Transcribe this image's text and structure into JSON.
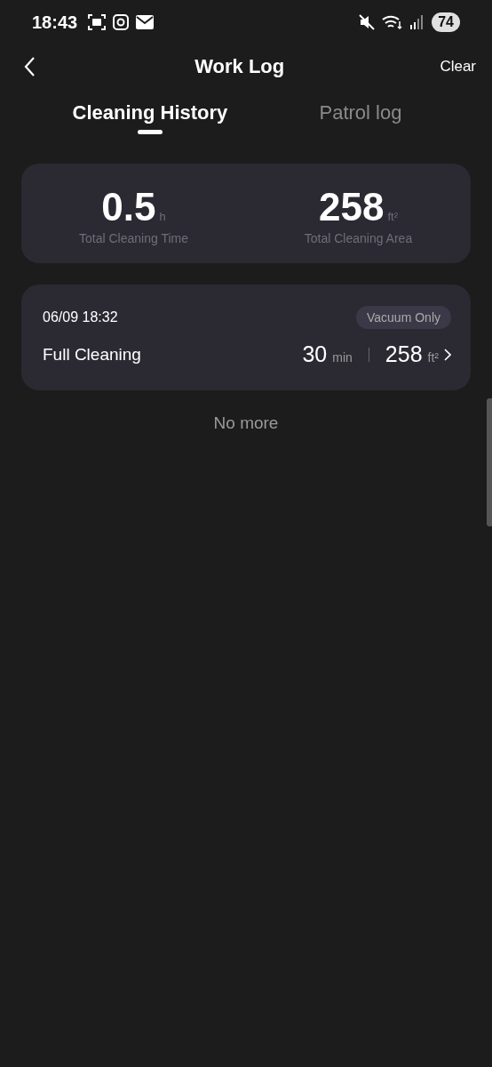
{
  "status_bar": {
    "time": "18:43",
    "battery": "74"
  },
  "header": {
    "title": "Work Log",
    "action": "Clear"
  },
  "tabs": [
    {
      "label": "Cleaning History",
      "selected": true
    },
    {
      "label": "Patrol log",
      "selected": false
    }
  ],
  "summary": [
    {
      "value": "0.5",
      "unit": "h",
      "label": "Total Cleaning Time"
    },
    {
      "value": "258",
      "unit": "ft²",
      "label": "Total Cleaning Area"
    }
  ],
  "records": [
    {
      "datetime": "06/09 18:32",
      "mode": "Vacuum Only",
      "name": "Full Cleaning",
      "duration": "30",
      "duration_unit": "min",
      "area": "258",
      "area_unit": "ft²"
    }
  ],
  "footer": "No more"
}
